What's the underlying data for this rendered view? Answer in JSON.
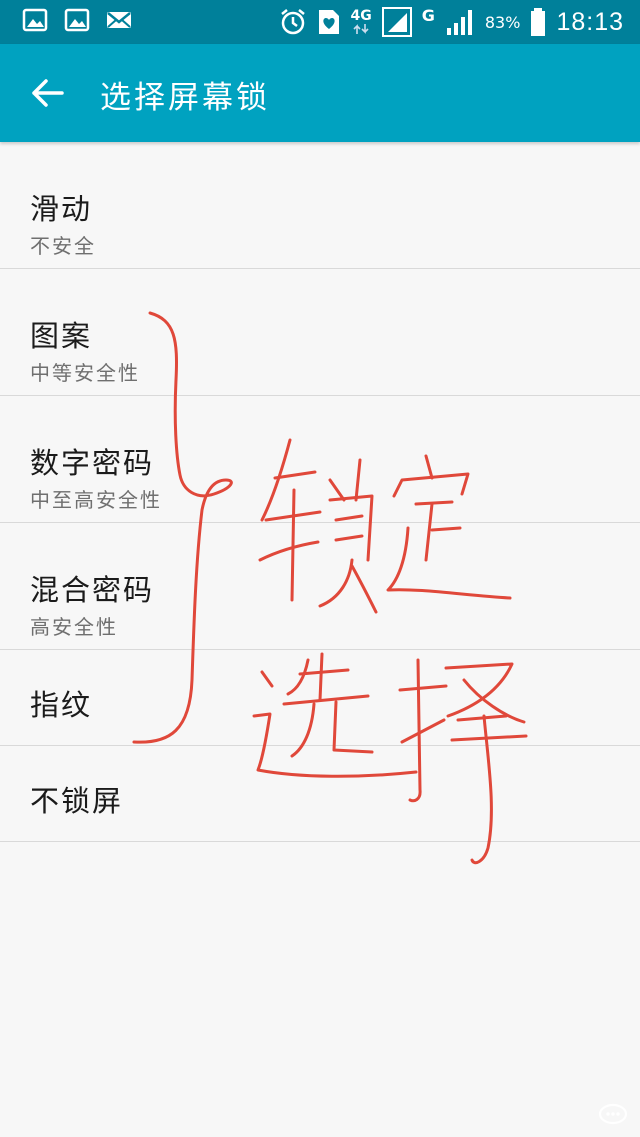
{
  "status_bar": {
    "signal_4g": "4G",
    "signal_g": "G",
    "battery": "83%",
    "time": "18:13"
  },
  "app_bar": {
    "title": "选择屏幕锁"
  },
  "lock_options": [
    {
      "title": "滑动",
      "subtitle": "不安全"
    },
    {
      "title": "图案",
      "subtitle": "中等安全性"
    },
    {
      "title": "数字密码",
      "subtitle": "中至高安全性"
    },
    {
      "title": "混合密码",
      "subtitle": "高安全性"
    },
    {
      "title": "指纹"
    },
    {
      "title": "不锁屏"
    }
  ],
  "colors": {
    "status_bar": "#00809a",
    "app_bar": "#00a2c0",
    "background": "#f7f7f7",
    "annotation_ink": "#e0483a"
  },
  "icons": [
    "gallery-icon",
    "gallery-icon",
    "mail-icon",
    "alarm-icon",
    "heart-file-icon",
    "signal-icon",
    "battery-icon",
    "back-arrow-icon"
  ]
}
